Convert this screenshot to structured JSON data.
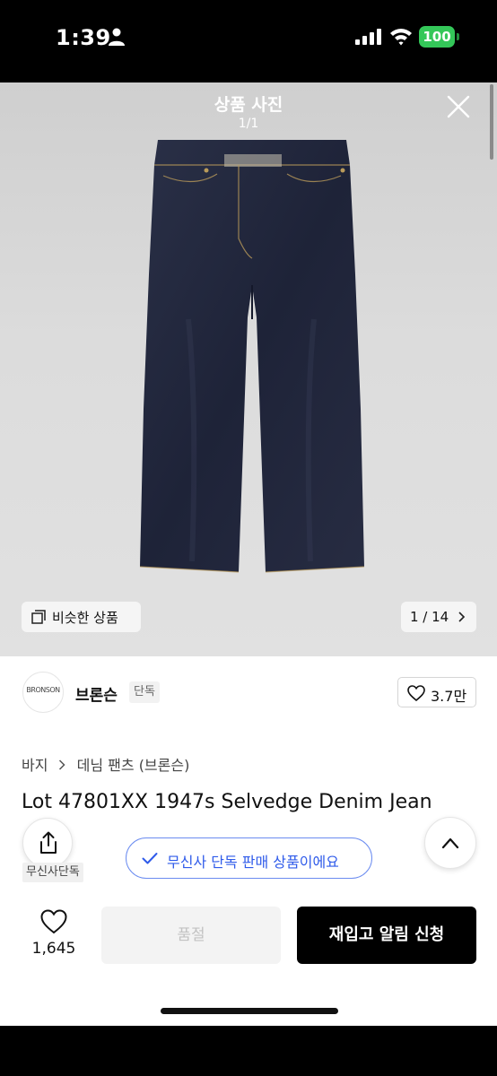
{
  "status_bar": {
    "time": "1:39",
    "battery": "100"
  },
  "viewer": {
    "title": "상품 사진",
    "counter": "1/1"
  },
  "gallery": {
    "similar_label": "비슷한 상품",
    "page_label": "1 / 14"
  },
  "brand": {
    "logo_text": "BRONSON",
    "name": "브론슨",
    "badge": "단독",
    "likes": "3.7만"
  },
  "product": {
    "breadcrumb": [
      "바지",
      "데님 팬츠 (브론슨)"
    ],
    "title": "Lot 47801XX 1947s Selvedge Denim Jean",
    "exclusive_tag": "무신사단독",
    "notice": "무신사 단독 판매 상품이에요"
  },
  "actions": {
    "like_count": "1,645",
    "soldout_label": "품절",
    "restock_label": "재입고 알림 신청"
  },
  "colors": {
    "accent": "#2f5bea",
    "badge_green": "#34c759",
    "primary": "#000000"
  }
}
